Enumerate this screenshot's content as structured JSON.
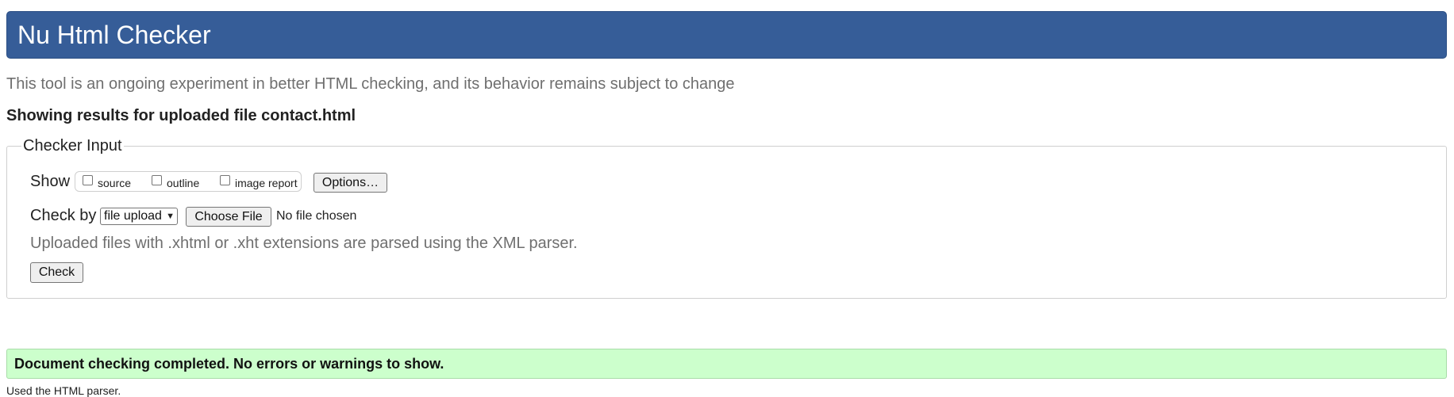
{
  "header": {
    "title": "Nu Html Checker"
  },
  "intro": "This tool is an ongoing experiment in better HTML checking, and its behavior remains subject to change",
  "results_heading": "Showing results for uploaded file contact.html",
  "checker_input": {
    "legend": "Checker Input",
    "show_label": "Show",
    "show_options": [
      {
        "label": "source",
        "checked": false
      },
      {
        "label": "outline",
        "checked": false
      },
      {
        "label": "image report",
        "checked": false
      }
    ],
    "options_button": "Options…",
    "check_by_label": "Check by",
    "check_by_value": "file upload",
    "choose_file_button": "Choose File",
    "file_status": "No file chosen",
    "note": "Uploaded files with .xhtml or .xht extensions are parsed using the XML parser.",
    "check_button": "Check"
  },
  "success_message": "Document checking completed. No errors or warnings to show.",
  "parser_note": "Used the HTML parser."
}
